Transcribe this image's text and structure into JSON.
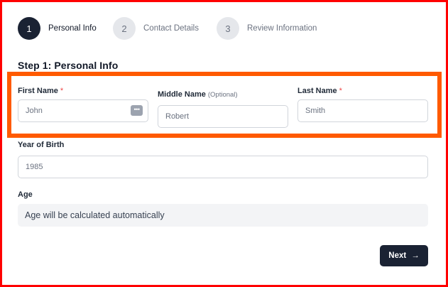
{
  "stepper": {
    "steps": [
      {
        "number": "1",
        "label": "Personal Info",
        "state": "active"
      },
      {
        "number": "2",
        "label": "Contact Details",
        "state": "inactive"
      },
      {
        "number": "3",
        "label": "Review Information",
        "state": "inactive"
      }
    ]
  },
  "form": {
    "title": "Step 1: Personal Info",
    "first_name": {
      "label": "First Name",
      "required_mark": "*",
      "placeholder": "John",
      "value": ""
    },
    "middle_name": {
      "label": "Middle Name",
      "optional_text": "(Optional)",
      "placeholder": "Robert",
      "value": ""
    },
    "last_name": {
      "label": "Last Name",
      "required_mark": "*",
      "placeholder": "Smith",
      "value": ""
    },
    "year_of_birth": {
      "label": "Year of Birth",
      "placeholder": "1985",
      "value": ""
    },
    "age": {
      "label": "Age",
      "value": "Age will be calculated automatically"
    }
  },
  "actions": {
    "next_label": "Next",
    "next_arrow": "→"
  },
  "icons": {
    "password_manager": "keyboard-dots-icon"
  },
  "colors": {
    "primary": "#1a2233",
    "required": "#ef4444",
    "highlight": "#ff5a00",
    "frame": "#ff0000"
  }
}
